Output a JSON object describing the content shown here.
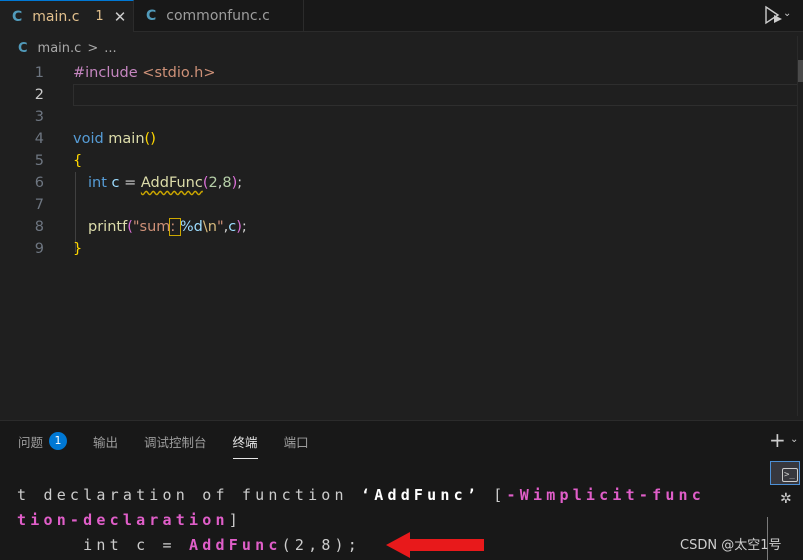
{
  "tabs": [
    {
      "icon": "C",
      "name": "main.c",
      "badge": "1",
      "close": "✕"
    },
    {
      "icon": "C",
      "name": "commonfunc.c"
    }
  ],
  "breadcrumb": {
    "icon": "C",
    "file": "main.c",
    "sep": ">",
    "more": "..."
  },
  "editor": {
    "line_numbers": [
      "1",
      "2",
      "3",
      "4",
      "5",
      "6",
      "7",
      "8",
      "9"
    ],
    "current_line": "2",
    "lines": [
      {
        "a": "#include",
        "b": " ",
        "c": "<stdio.h>"
      },
      {},
      {},
      {
        "kw": "void",
        "sp": " ",
        "fn": "main",
        "po": "(",
        "pc": ")"
      },
      {
        "brace": "{"
      },
      {
        "kw": "int",
        "sp1": " ",
        "var": "c",
        "eq": " = ",
        "fn": "AddFunc",
        "po": "(",
        "n1": "2",
        "comma": ",",
        "n2": "8",
        "pc": ")",
        "semi": ";"
      },
      {},
      {
        "fn": "printf",
        "po": "(",
        "s1": "\"sum",
        "s2": ": ",
        "s3": "%d",
        "esc": "\\n",
        "s4": "\"",
        "comma": ",",
        "var": "c",
        "pc": ")",
        "semi": ";"
      },
      {
        "brace": "}"
      }
    ]
  },
  "panel": {
    "tabs": [
      "问题",
      "输出",
      "调试控制台",
      "终端",
      "端口"
    ],
    "problems_count": "1",
    "active_tab": "终端",
    "add_label": "+",
    "caret": "⌄"
  },
  "terminal": {
    "row1": {
      "a": "t declaration of function ",
      "b": "‘AddFunc’",
      "c": " [",
      "d": "-Wimplicit-func"
    },
    "row2": {
      "a": "tion-declaration",
      "b": "]"
    },
    "row3": {
      "a": "     int c = ",
      "b": "AddFunc",
      "c": "(2,8);"
    }
  },
  "watermark": "CSDN @太空1号",
  "colors": {
    "accent": "#0078d4",
    "modified_tab": "#e2c08d",
    "arrow": "#e8191b",
    "terminal_highlight": "#e05ec9"
  }
}
